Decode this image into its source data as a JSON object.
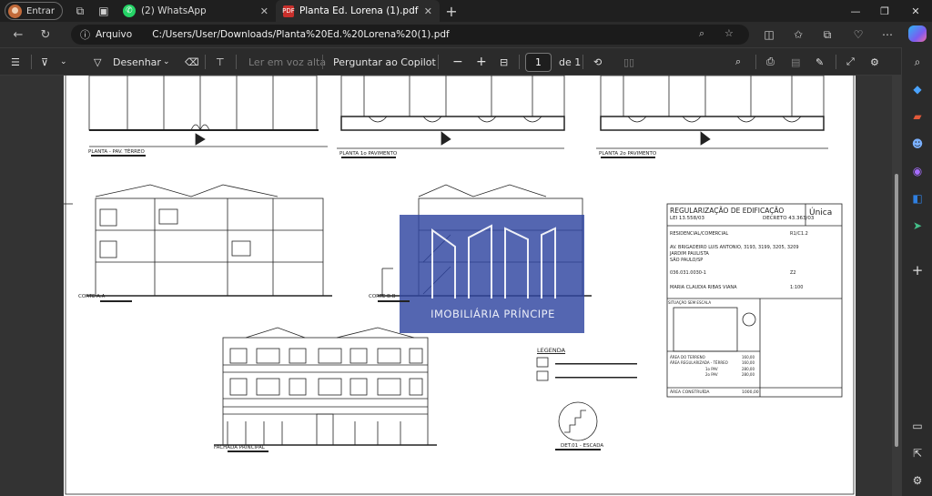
{
  "browser": {
    "profile_label": "Entrar",
    "tabs": [
      {
        "label": "(2) WhatsApp",
        "icon": "whatsapp-icon"
      },
      {
        "label": "Planta Ed. Lorena (1).pdf",
        "icon": "pdf-icon"
      }
    ],
    "address": {
      "scheme_label": "Arquivo",
      "path": "C:/Users/User/Downloads/Planta%20Ed.%20Lorena%20(1).pdf"
    }
  },
  "pdf_toolbar": {
    "draw_label": "Desenhar",
    "read_aloud_label": "Ler em voz alta",
    "copilot_label": "Perguntar ao Copilot",
    "page_current": "1",
    "page_total_label": "de 1"
  },
  "drawing": {
    "plans": [
      {
        "title": "PLANTA - PAV. TÉRREO"
      },
      {
        "title": "PLANTA 1o PAVIMENTO"
      },
      {
        "title": "PLANTA 2o PAVIMENTO"
      }
    ],
    "sections": [
      "CORTE A.A",
      "CORTE B.B"
    ],
    "facade_title": "FACHADA PRINCIPAL",
    "stair_detail": "DET.01 - ESCADA",
    "legend_title": "LEGENDA",
    "watermark": "IMOBILIÁRIA PRÍNCIPE",
    "title_block": {
      "heading": "REGULARIZAÇÃO DE EDIFICAÇÃO",
      "sheet": "Única",
      "law": "LEI 13.558/03",
      "decree": "DECRETO 43.363/03",
      "use": "RESIDENCIAL/COMERCIAL",
      "use_code": "R1/C1.2",
      "address_line1": "AV. BRIGADEIRO LUIS ANTONIO, 3193, 3199, 3205, 3209",
      "address_line2": "JARDIM PAULISTA",
      "address_line3": "SÃO PAULO/SP",
      "contrib": "036.031.0030-1",
      "zone": "Z2",
      "owner": "MARIA CLAUDIA RIBAS VIANA",
      "scale": "1:100",
      "situation_label": "SITUAÇÃO SEM ESCALA",
      "area_rows": [
        {
          "label": "ÁREA DO TERRENO",
          "value": "160,00"
        },
        {
          "label": "ÁREA REGULARIZADA - TÉRREO",
          "value": "160,00"
        },
        {
          "label": "1o PAV",
          "value": "280,00"
        },
        {
          "label": "2o PAV",
          "value": "280,00"
        }
      ],
      "built_area_label": "ÁREA CONSTRUÍDA",
      "built_area_value": "1000,00"
    }
  }
}
